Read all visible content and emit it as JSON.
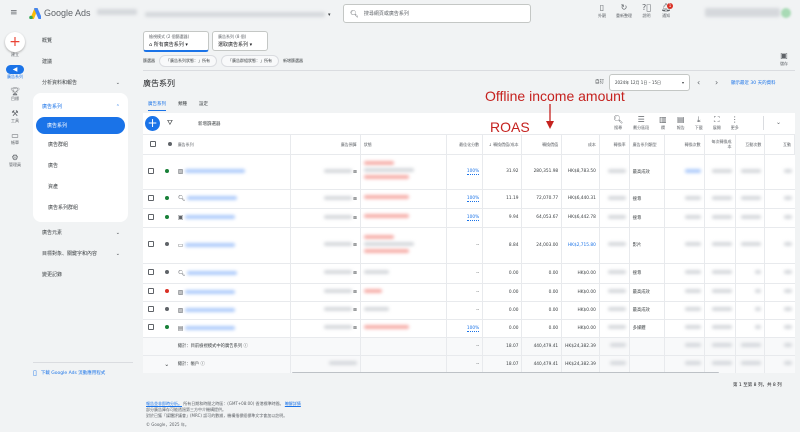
{
  "app": {
    "name": "Google Ads",
    "search_placeholder": "搜尋網頁或廣告系列"
  },
  "topbar": {
    "actions": [
      {
        "label": "外觀",
        "icon": "appearance-icon"
      },
      {
        "label": "重新整理",
        "icon": "refresh-icon"
      },
      {
        "label": "說明",
        "icon": "help-icon"
      },
      {
        "label": "通知",
        "icon": "bell-icon",
        "badge": "1"
      }
    ]
  },
  "rail": [
    {
      "label": "建立",
      "icon": "plus-icon"
    },
    {
      "label": "廣告系列",
      "icon": "megaphone-icon",
      "active": true
    },
    {
      "label": "目標",
      "icon": "trophy-icon"
    },
    {
      "label": "工具",
      "icon": "tools-icon"
    },
    {
      "label": "帳單",
      "icon": "billing-icon"
    },
    {
      "label": "管理員",
      "icon": "gear-icon"
    }
  ],
  "nav": {
    "items": [
      "概覽",
      "建議",
      "分析資料和報告"
    ],
    "group_title": "廣告系列",
    "group_items": [
      "廣告系列",
      "廣告群組",
      "廣告",
      "資產",
      "廣告系列群組"
    ],
    "after": [
      "廣告元素",
      "目標對象、關鍵字和內容",
      "變更記錄"
    ],
    "download_app": "下載 Google Ads 流動應用程式"
  },
  "filters": {
    "view_label": "檢視模式 (2 個篩選器)",
    "view_value": "所有廣告系列",
    "campaign_label": "廣告系列 (8 個)",
    "campaign_value": "選取廣告系列",
    "filter_label": "篩選器",
    "chips": [
      "「廣告系列狀態：」所有",
      "「廣告群組狀態：」所有"
    ],
    "add_filter": "新增篩選器",
    "save": "儲存"
  },
  "page": {
    "title": "廣告系列",
    "tabs": [
      "廣告系列",
      "類種",
      "設定"
    ],
    "date_label": "自訂",
    "date_range": "2024年 12月 1日 – 15日",
    "compare_link": "顯示最近 30 天的資料"
  },
  "toolbar": {
    "add_filter": "新增篩選器",
    "tools": [
      {
        "label": "搜尋",
        "icon": "search-icon"
      },
      {
        "label": "劃分區段",
        "icon": "segment-icon"
      },
      {
        "label": "欄",
        "icon": "columns-icon"
      },
      {
        "label": "報告",
        "icon": "report-icon"
      },
      {
        "label": "下載",
        "icon": "download-icon"
      },
      {
        "label": "展開",
        "icon": "expand-icon"
      },
      {
        "label": "更多",
        "icon": "more-icon"
      }
    ]
  },
  "annotations": {
    "offline": "Offline income amount",
    "roas": "ROAS"
  },
  "table": {
    "headers": [
      "廣告系列",
      "廣告預算",
      "狀態",
      "最佳化分數",
      "轉換價值/成本",
      "轉換價值",
      "成本",
      "轉換率",
      "廣告系列類型",
      "轉換次數",
      "每次轉換成本",
      "互動次數",
      "互動"
    ],
    "rows": [
      {
        "status": "#188038",
        "opt": "100%",
        "roas": "31.92",
        "value": "280,351.98",
        "cost": "HK$8,783.50",
        "type": "最高成效"
      },
      {
        "status": "#188038",
        "opt": "100%",
        "roas": "11.19",
        "value": "72,070.77",
        "cost": "HK$6,440.31",
        "type": "搜尋"
      },
      {
        "status": "#188038",
        "opt": "100%",
        "roas": "9.94",
        "value": "64,053.67",
        "cost": "HK$6,442.78",
        "type": "搜尋"
      },
      {
        "status": "#5f6368",
        "opt": "--",
        "roas": "8.84",
        "value": "24,003.00",
        "cost": "HK$2,715.80",
        "type": "影片"
      },
      {
        "status": "#5f6368",
        "opt": "--",
        "roas": "0.00",
        "value": "0.00",
        "cost": "HK$0.00",
        "type": "搜尋"
      },
      {
        "status": "#d93025",
        "opt": "--",
        "roas": "0.00",
        "value": "0.00",
        "cost": "HK$0.00",
        "type": "最高成效"
      },
      {
        "status": "#5f6368",
        "opt": "--",
        "roas": "0.00",
        "value": "0.00",
        "cost": "HK$0.00",
        "type": "最高成效"
      },
      {
        "status": "#188038",
        "opt": "100%",
        "roas": "0.00",
        "value": "0.00",
        "cost": "HK$0.00",
        "type": "多媒體"
      }
    ],
    "totals": [
      {
        "label": "總計：目前檢視模式中的廣告系列",
        "opt": "--",
        "roas": "18.07",
        "value": "440,479.41",
        "cost": "HK$24,382.39"
      },
      {
        "label": "總計：帳戶",
        "opt": "--",
        "roas": "18.07",
        "value": "440,479.41",
        "cost": "HK$24,382.39"
      }
    ],
    "pagination": "第 1 至第 8 列，共 8 列"
  },
  "footer": {
    "line1a": "報告並非即時分析。",
    "line1b": "所有日期和時間之時區：(GMT+08:00) 香港標準時間。",
    "line1c": "瞭解詳情",
    "line2": "部分廣告庫存可能透過第三方中介機構提供。",
    "line3": "對於已獲「媒體評議會」(MRC) 認可的數據，機構指標經標準文字會加以註明。",
    "copyright": "© Google，2025 年。"
  }
}
